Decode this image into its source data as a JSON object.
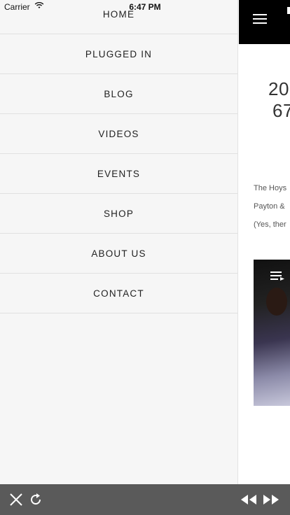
{
  "status_bar": {
    "carrier": "Carrier",
    "time": "6:47 PM"
  },
  "menu": {
    "items": [
      {
        "label": "HOME"
      },
      {
        "label": "PLUGGED IN"
      },
      {
        "label": "BLOG"
      },
      {
        "label": "VIDEOS"
      },
      {
        "label": "EVENTS"
      },
      {
        "label": "SHOP"
      },
      {
        "label": "ABOUT US"
      },
      {
        "label": "CONTACT"
      }
    ]
  },
  "content_peek": {
    "heading_line1": "20",
    "heading_line2": "67",
    "text_lines": [
      "The Hoys",
      "Payton &",
      "(Yes, ther"
    ]
  },
  "icons": {
    "wifi": "wifi-icon",
    "menu": "hamburger-menu-icon",
    "playlist": "playlist-icon",
    "close": "close-icon",
    "reload": "reload-icon",
    "back": "rewind-icon",
    "forward": "fast-forward-icon"
  },
  "colors": {
    "menu_bg": "#f6f6f6",
    "top_bar": "#000000",
    "toolbar": "#5a5a5a"
  }
}
